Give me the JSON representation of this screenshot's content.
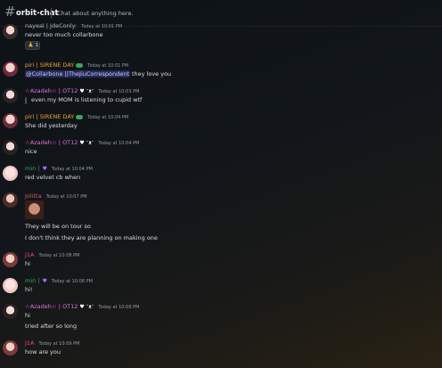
{
  "channel": {
    "name": "orbit-chat",
    "topic": "Chat about anything here."
  },
  "colors": {
    "piri": "#f0a030",
    "azadeh": "#e36fd9",
    "min": "#3ba55d",
    "jolitta": "#e0506b",
    "jia": "#e8467c",
    "nayeal": "#b5bac1"
  },
  "messages": [
    {
      "author": "nayeal | JdeConly:",
      "time": "Today at 10:01 PM",
      "lines": [
        "never too much collarbone"
      ],
      "reaction": {
        "emoji": "🙏",
        "count": "1"
      }
    },
    {
      "author": "piri | SIRENE DAY",
      "time": "Today at 10:01 PM",
      "mention": "@Collarbone ||TheJiuCorrespondent",
      "lines": [
        " they love you"
      ]
    },
    {
      "author": "☆Azadeh☆ | OT12",
      "time": "Today at 10:03 PM",
      "lines": [
        "even my MOM is listening to cupid wtf"
      ]
    },
    {
      "author": "piri | SIRENE DAY",
      "time": "Today at 10:04 PM",
      "lines": [
        "She did yesterday"
      ]
    },
    {
      "author": "☆Azadeh☆ | OT12",
      "time": "Today at 10:04 PM",
      "lines": [
        "nice"
      ]
    },
    {
      "author": "min |",
      "time": "Today at 10:04 PM",
      "lines": [
        "red velvet cb when"
      ]
    },
    {
      "author": "Jolitta",
      "time": "Today at 10:07 PM",
      "lines": [
        "They will be on tour so",
        "I don't think they are planning on making one"
      ]
    },
    {
      "author": "J1A",
      "time": "Today at 10:08 PM",
      "lines": [
        "hi"
      ]
    },
    {
      "author": "min |",
      "time": "Today at 10:08 PM",
      "lines": [
        "hi!"
      ]
    },
    {
      "author": "☆Azadeh☆ | OT12",
      "time": "Today at 10:08 PM",
      "lines": [
        "hi",
        "tried after so long"
      ]
    },
    {
      "author": "J1A",
      "time": "Today at 10:09 PM",
      "lines": [
        "how are you"
      ]
    }
  ]
}
